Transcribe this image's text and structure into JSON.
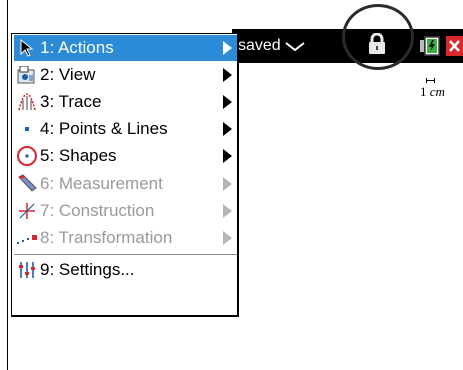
{
  "toolbar": {
    "doc_status": "saved"
  },
  "scale": {
    "value": "1",
    "unit": "cm"
  },
  "menu": {
    "items": [
      {
        "label": "1: Actions",
        "icon": "cursor-arrow-icon",
        "enabled": true,
        "selected": true,
        "submenu": true
      },
      {
        "label": "2: View",
        "icon": "view-icon",
        "enabled": true,
        "selected": false,
        "submenu": true
      },
      {
        "label": "3: Trace",
        "icon": "trace-icon",
        "enabled": true,
        "selected": false,
        "submenu": true
      },
      {
        "label": "4: Points & Lines",
        "icon": "point-icon",
        "enabled": true,
        "selected": false,
        "submenu": true
      },
      {
        "label": "5: Shapes",
        "icon": "circle-shape-icon",
        "enabled": true,
        "selected": false,
        "submenu": true
      },
      {
        "label": "6: Measurement",
        "icon": "ruler-icon",
        "enabled": false,
        "selected": false,
        "submenu": true
      },
      {
        "label": "7: Construction",
        "icon": "construction-icon",
        "enabled": false,
        "selected": false,
        "submenu": true
      },
      {
        "label": "8: Transformation",
        "icon": "transformation-icon",
        "enabled": false,
        "selected": false,
        "submenu": true
      },
      {
        "label": "9: Settings...",
        "icon": "settings-sliders-icon",
        "enabled": true,
        "selected": false,
        "submenu": false
      }
    ]
  },
  "colors": {
    "selection": "#2c8bd6",
    "disabled_text": "#9a9a9a",
    "toolbar_bg": "#000000",
    "close_red": "#d9272e"
  }
}
